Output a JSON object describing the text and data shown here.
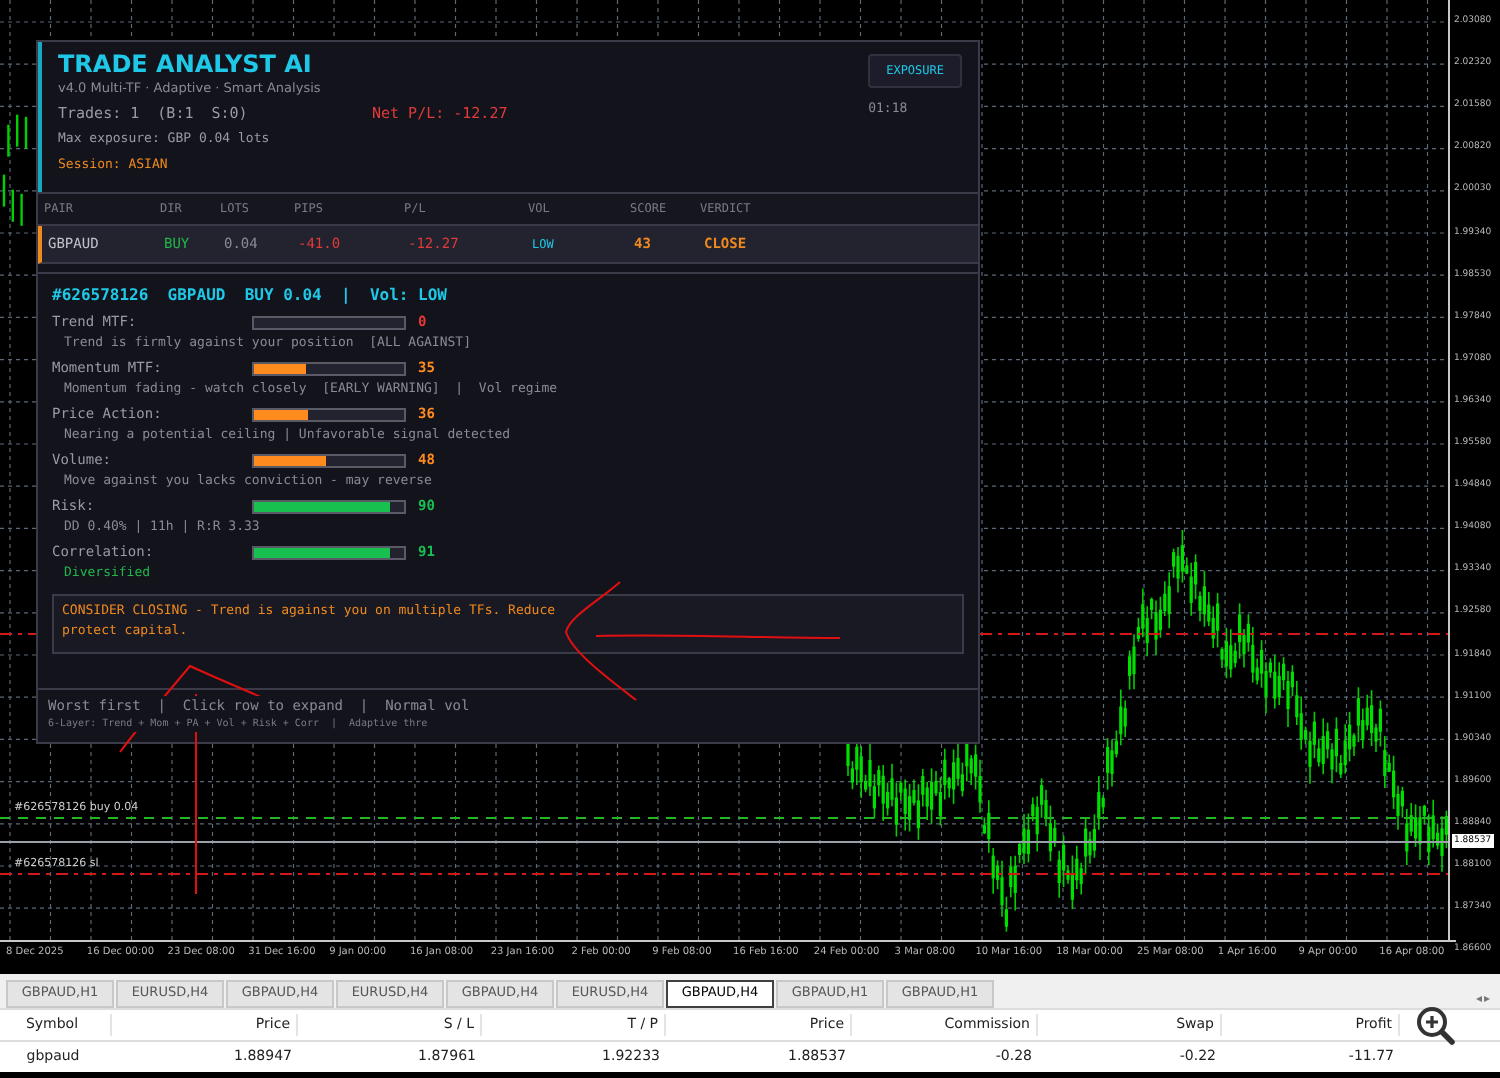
{
  "chart": {
    "price_labels": [
      "2.03080",
      "2.02320",
      "2.01580",
      "2.00820",
      "2.00030",
      "1.99340",
      "1.98530",
      "1.97840",
      "1.97080",
      "1.96340",
      "1.95580",
      "1.94840",
      "1.94080",
      "1.93340",
      "1.92580",
      "1.91840",
      "1.91100",
      "1.90340",
      "1.89600",
      "1.88840",
      "1.88100",
      "1.87340",
      "1.86600"
    ],
    "current_price": "1.88537",
    "date_labels": [
      "8 Dec 2025",
      "16 Dec 00:00",
      "23 Dec 08:00",
      "31 Dec 16:00",
      "9 Jan 00:00",
      "16 Jan 08:00",
      "23 Jan 16:00",
      "2 Feb 00:00",
      "9 Feb 08:00",
      "16 Feb 16:00",
      "24 Feb 00:00",
      "3 Mar 08:00",
      "10 Mar 16:00",
      "18 Mar 00:00",
      "25 Mar 08:00",
      "1 Apr 16:00",
      "9 Apr 00:00",
      "16 Apr 08:00"
    ],
    "order_lines": [
      {
        "kind": "tp"
      },
      {
        "kind": "entry",
        "label": "#626578126 buy 0.04"
      },
      {
        "kind": "sl",
        "label": "#626578126 sl"
      }
    ]
  },
  "panel": {
    "title": "TRADE ANALYST AI",
    "subtitle": "v4.0 Multi-TF · Adaptive · Smart Analysis",
    "trades": "Trades: 1  (B:1  S:0)",
    "net_pl": "Net P/L: -12.27",
    "max_exposure": "Max exposure: GBP 0.04 lots",
    "session": "Session: ASIAN",
    "exposure_button": "EXPOSURE",
    "clock": "01:18",
    "columns": [
      "PAIR",
      "DIR",
      "LOTS",
      "PIPS",
      "P/L",
      "VOL",
      "SCORE",
      "VERDICT"
    ],
    "rows": [
      {
        "pair": "GBPAUD",
        "dir": "BUY",
        "lots": "0.04",
        "pips": "-41.0",
        "pl": "-12.27",
        "vol": "LOW",
        "score": "43",
        "verdict": "CLOSE",
        "selected": true
      }
    ],
    "detail": {
      "heading": "#626578126  GBPAUD  BUY 0.04  |  Vol: LOW",
      "factors": [
        {
          "label": "Trend MTF:",
          "level": 0,
          "score": "0",
          "color": "#e83838",
          "note": "Trend is firmly against your position  [ALL AGAINST]",
          "note_highlight": false
        },
        {
          "label": "Momentum MTF:",
          "level": 0.35,
          "score": "35",
          "color": "#ff8a1e",
          "note": "Momentum fading - watch closely  [EARLY WARNING]  |  Vol regime",
          "note_highlight": false
        },
        {
          "label": "Price Action:",
          "level": 0.36,
          "score": "36",
          "color": "#ff8a1e",
          "note": "Nearing a potential ceiling | Unfavorable signal detected",
          "note_highlight": false
        },
        {
          "label": "Volume:",
          "level": 0.48,
          "score": "48",
          "color": "#ff8a1e",
          "note": "Move against you lacks conviction - may reverse",
          "note_highlight": false
        },
        {
          "label": "Risk:",
          "level": 0.9,
          "score": "90",
          "color": "#18c050",
          "note": "DD 0.40% | 11h | R:R 3.33",
          "note_highlight": false
        },
        {
          "label": "Correlation:",
          "level": 0.91,
          "score": "91",
          "color": "#18c050",
          "note": "Diversified",
          "note_highlight": true
        }
      ],
      "advice": "CONSIDER CLOSING - Trend is against you on multiple TFs. Reduce protect capital."
    },
    "footer": {
      "line1": "Worst first  |  Click row to expand  |  Normal vol",
      "line2": "6-Layer: Trend + Mom + PA + Vol + Risk + Corr  |  Adaptive thre"
    }
  },
  "tab_scroll": [
    "◂",
    "▸"
  ],
  "tabs": [
    {
      "label": "GBPAUD,H1",
      "selected": false
    },
    {
      "label": "EURUSD,H4",
      "selected": false
    },
    {
      "label": "GBPAUD,H4",
      "selected": false
    },
    {
      "label": "EURUSD,H4",
      "selected": false
    },
    {
      "label": "GBPAUD,H4",
      "selected": false
    },
    {
      "label": "EURUSD,H4",
      "selected": false
    },
    {
      "label": "GBPAUD,H4",
      "selected": true
    },
    {
      "label": "GBPAUD,H1",
      "selected": false
    },
    {
      "label": "GBPAUD,H1",
      "selected": false
    }
  ],
  "positions": {
    "columns": [
      "Symbol",
      "Price",
      "S / L",
      "T / P",
      "Price",
      "Commission",
      "Swap",
      "Profit"
    ],
    "rows": [
      [
        "gbpaud",
        "1.88947",
        "1.87961",
        "1.92233",
        "1.88537",
        "-0.28",
        "-0.22",
        "-11.77"
      ]
    ]
  }
}
